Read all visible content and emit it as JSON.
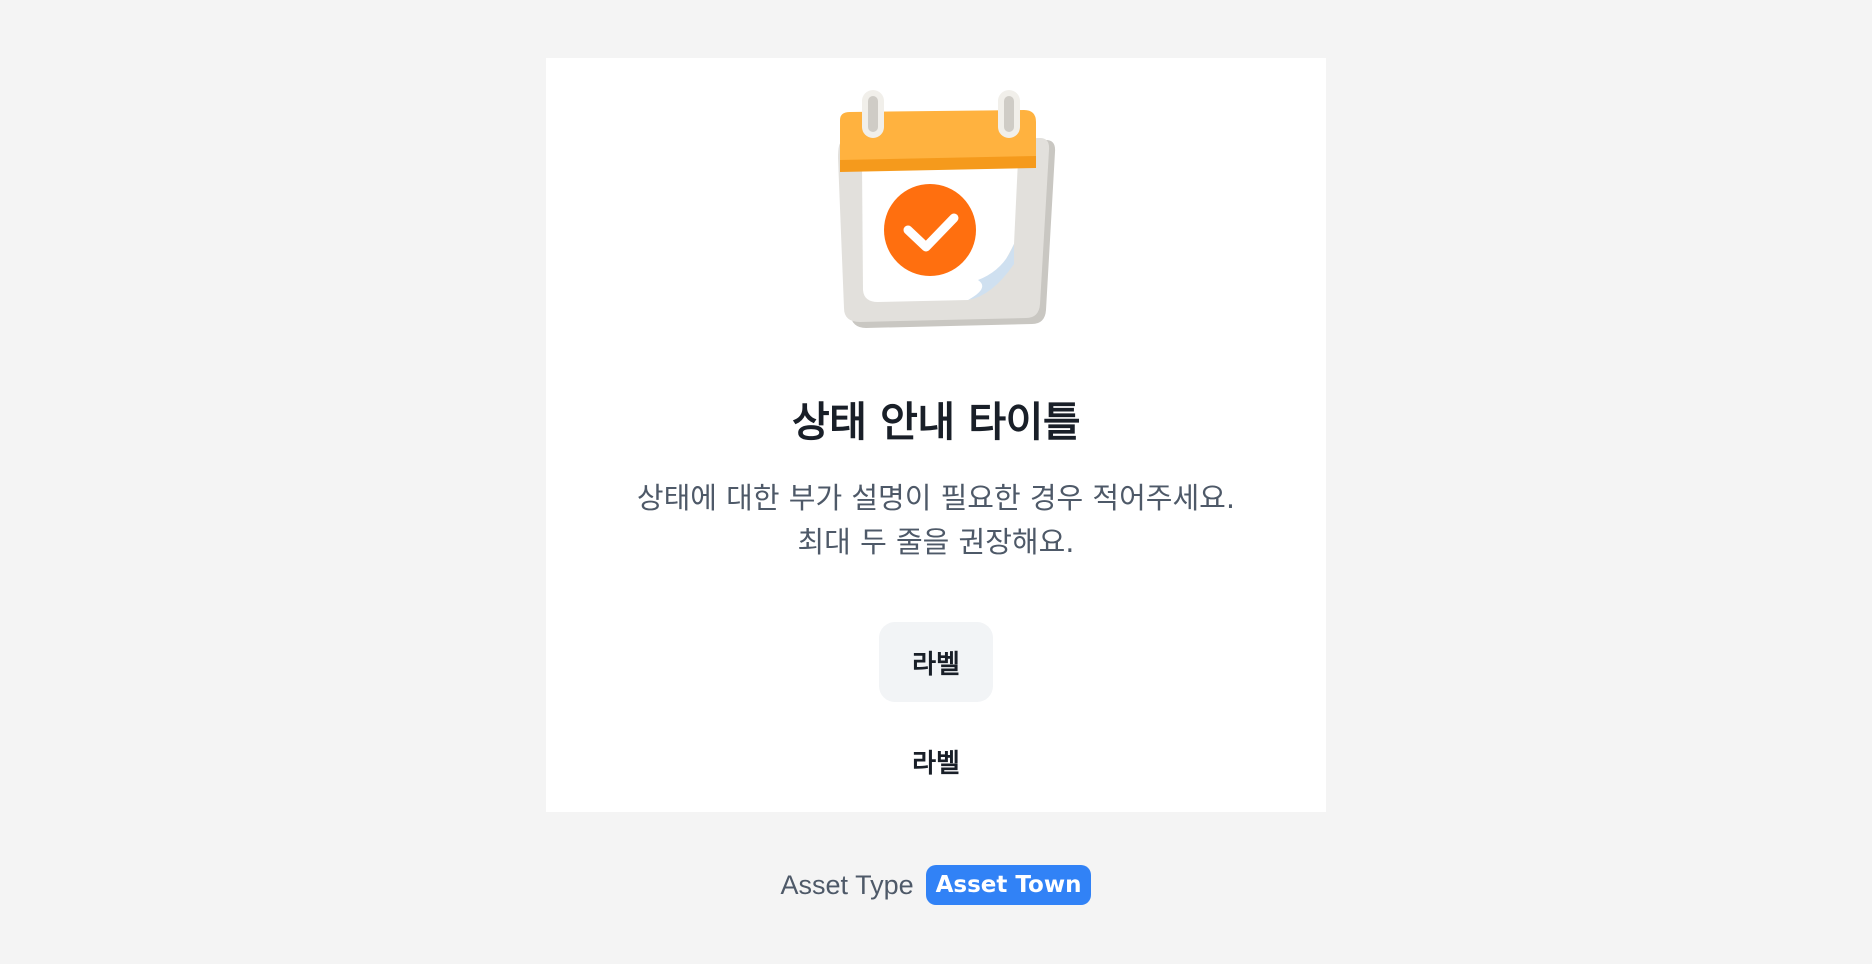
{
  "status": {
    "title": "상태 안내 타이틀",
    "description": "상태에 대한 부가 설명이 필요한 경우 적어주세요. 최대 두 줄을 권장해요.",
    "illustration_icon": "calendar-check-icon"
  },
  "actions": {
    "primary_label": "라벨",
    "secondary_label": "라벨"
  },
  "asset": {
    "type_label": "Asset Type",
    "badge": "Asset Town"
  },
  "colors": {
    "background": "#f4f4f4",
    "card": "#ffffff",
    "title": "#191f28",
    "description": "#4e5968",
    "primary_button_bg": "#f2f4f6",
    "badge": "#3182f6",
    "calendar_header": "#ffb23f",
    "check_circle": "#ff6f0f"
  }
}
